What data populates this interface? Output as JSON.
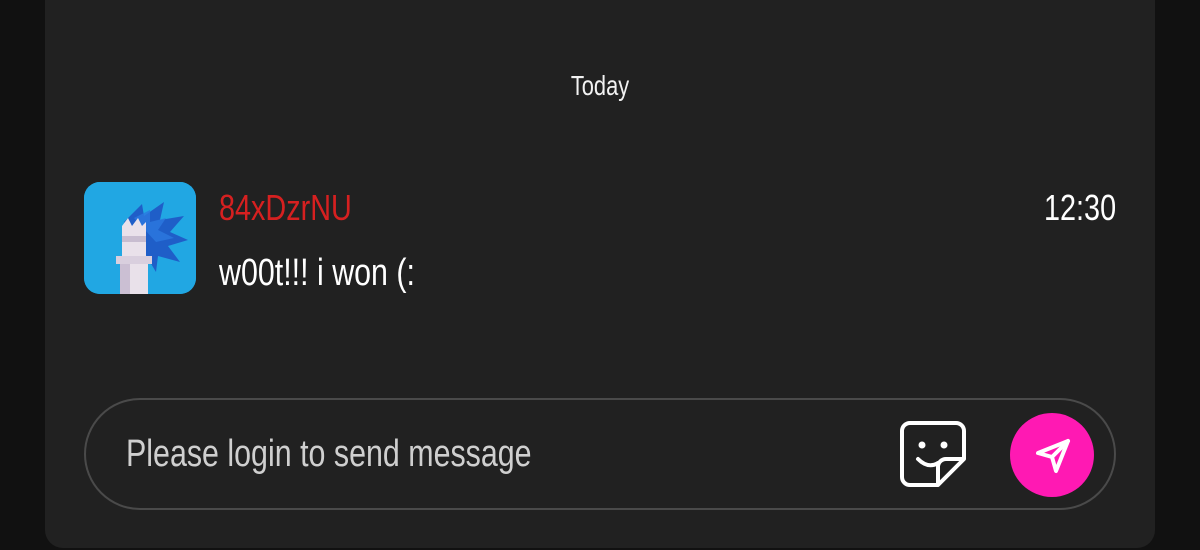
{
  "chat": {
    "date_divider": "Today",
    "messages": [
      {
        "username": "84xDzrNU",
        "time": "12:30",
        "text": "w00t!!! i won (:",
        "username_color": "#d62020",
        "avatar": "sonic-knight-avatar"
      }
    ]
  },
  "composer": {
    "placeholder": "Please login to send message",
    "value": "",
    "sticker_icon": "sticker-icon",
    "send_icon": "send-icon"
  },
  "colors": {
    "background": "#111111",
    "panel": "#212121",
    "send_accent": "#ff19b3"
  }
}
